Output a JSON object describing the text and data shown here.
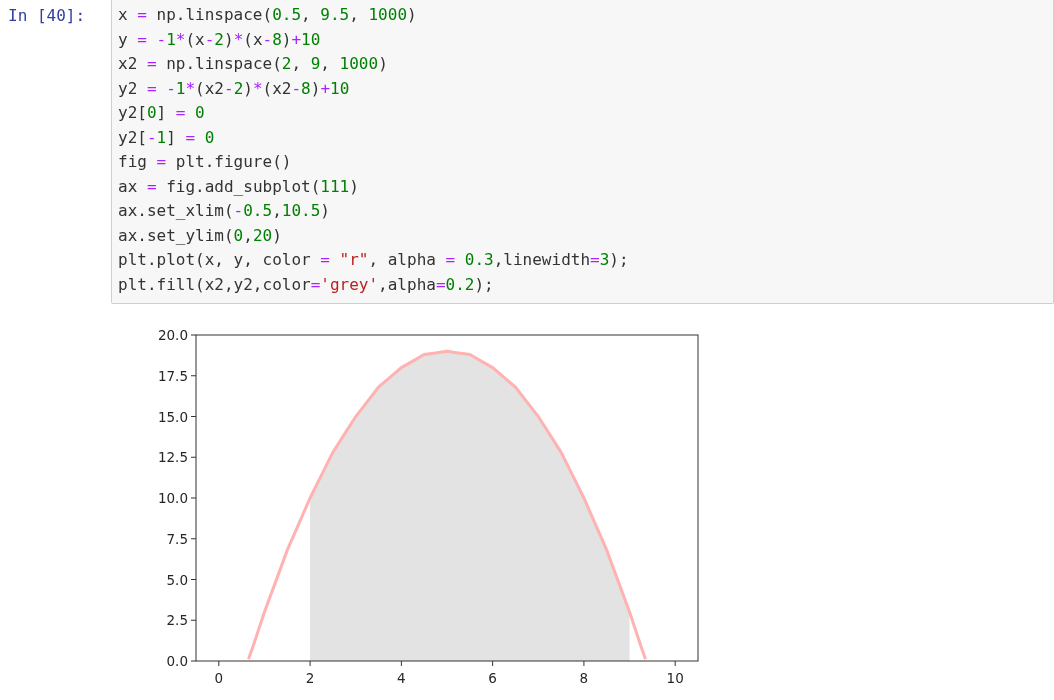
{
  "cell": {
    "prompt": "In [40]:",
    "code_lines": [
      [
        {
          "kind": "plain",
          "text": "x "
        },
        {
          "kind": "op",
          "text": "="
        },
        {
          "kind": "plain",
          "text": " np.linspace("
        },
        {
          "kind": "num",
          "text": "0.5"
        },
        {
          "kind": "plain",
          "text": ", "
        },
        {
          "kind": "num",
          "text": "9.5"
        },
        {
          "kind": "plain",
          "text": ", "
        },
        {
          "kind": "num",
          "text": "1000"
        },
        {
          "kind": "plain",
          "text": ")"
        }
      ],
      [
        {
          "kind": "plain",
          "text": "y "
        },
        {
          "kind": "op",
          "text": "= -"
        },
        {
          "kind": "num",
          "text": "1"
        },
        {
          "kind": "op",
          "text": "*"
        },
        {
          "kind": "plain",
          "text": "(x"
        },
        {
          "kind": "op",
          "text": "-"
        },
        {
          "kind": "num",
          "text": "2"
        },
        {
          "kind": "plain",
          "text": ")"
        },
        {
          "kind": "op",
          "text": "*"
        },
        {
          "kind": "plain",
          "text": "(x"
        },
        {
          "kind": "op",
          "text": "-"
        },
        {
          "kind": "num",
          "text": "8"
        },
        {
          "kind": "plain",
          "text": ")"
        },
        {
          "kind": "op",
          "text": "+"
        },
        {
          "kind": "num",
          "text": "10"
        }
      ],
      [
        {
          "kind": "plain",
          "text": "x2 "
        },
        {
          "kind": "op",
          "text": "="
        },
        {
          "kind": "plain",
          "text": " np.linspace("
        },
        {
          "kind": "num",
          "text": "2"
        },
        {
          "kind": "plain",
          "text": ", "
        },
        {
          "kind": "num",
          "text": "9"
        },
        {
          "kind": "plain",
          "text": ", "
        },
        {
          "kind": "num",
          "text": "1000"
        },
        {
          "kind": "plain",
          "text": ")"
        }
      ],
      [
        {
          "kind": "plain",
          "text": "y2 "
        },
        {
          "kind": "op",
          "text": "= -"
        },
        {
          "kind": "num",
          "text": "1"
        },
        {
          "kind": "op",
          "text": "*"
        },
        {
          "kind": "plain",
          "text": "(x2"
        },
        {
          "kind": "op",
          "text": "-"
        },
        {
          "kind": "num",
          "text": "2"
        },
        {
          "kind": "plain",
          "text": ")"
        },
        {
          "kind": "op",
          "text": "*"
        },
        {
          "kind": "plain",
          "text": "(x2"
        },
        {
          "kind": "op",
          "text": "-"
        },
        {
          "kind": "num",
          "text": "8"
        },
        {
          "kind": "plain",
          "text": ")"
        },
        {
          "kind": "op",
          "text": "+"
        },
        {
          "kind": "num",
          "text": "10"
        }
      ],
      [
        {
          "kind": "plain",
          "text": "y2["
        },
        {
          "kind": "num",
          "text": "0"
        },
        {
          "kind": "plain",
          "text": "] "
        },
        {
          "kind": "op",
          "text": "="
        },
        {
          "kind": "num",
          "text": " 0"
        }
      ],
      [
        {
          "kind": "plain",
          "text": "y2["
        },
        {
          "kind": "op",
          "text": "-"
        },
        {
          "kind": "num",
          "text": "1"
        },
        {
          "kind": "plain",
          "text": "] "
        },
        {
          "kind": "op",
          "text": "="
        },
        {
          "kind": "num",
          "text": " 0"
        }
      ],
      [
        {
          "kind": "plain",
          "text": "fig "
        },
        {
          "kind": "op",
          "text": "="
        },
        {
          "kind": "plain",
          "text": " plt.figure()"
        }
      ],
      [
        {
          "kind": "plain",
          "text": "ax "
        },
        {
          "kind": "op",
          "text": "="
        },
        {
          "kind": "plain",
          "text": " fig.add_subplot("
        },
        {
          "kind": "num",
          "text": "111"
        },
        {
          "kind": "plain",
          "text": ")"
        }
      ],
      [
        {
          "kind": "plain",
          "text": "ax.set_xlim("
        },
        {
          "kind": "op",
          "text": "-"
        },
        {
          "kind": "num",
          "text": "0.5"
        },
        {
          "kind": "plain",
          "text": ","
        },
        {
          "kind": "num",
          "text": "10.5"
        },
        {
          "kind": "plain",
          "text": ")"
        }
      ],
      [
        {
          "kind": "plain",
          "text": "ax.set_ylim("
        },
        {
          "kind": "num",
          "text": "0"
        },
        {
          "kind": "plain",
          "text": ","
        },
        {
          "kind": "num",
          "text": "20"
        },
        {
          "kind": "plain",
          "text": ")"
        }
      ],
      [
        {
          "kind": "plain",
          "text": "plt.plot(x, y, color "
        },
        {
          "kind": "op",
          "text": "="
        },
        {
          "kind": "str",
          "text": " \"r\""
        },
        {
          "kind": "plain",
          "text": ", alpha "
        },
        {
          "kind": "op",
          "text": "="
        },
        {
          "kind": "num",
          "text": " 0.3"
        },
        {
          "kind": "plain",
          "text": ",linewidth"
        },
        {
          "kind": "op",
          "text": "="
        },
        {
          "kind": "num",
          "text": "3"
        },
        {
          "kind": "plain",
          "text": ");"
        }
      ],
      [
        {
          "kind": "plain",
          "text": "plt.fill(x2,y2,color"
        },
        {
          "kind": "op",
          "text": "="
        },
        {
          "kind": "str",
          "text": "'grey'"
        },
        {
          "kind": "plain",
          "text": ",alpha"
        },
        {
          "kind": "op",
          "text": "="
        },
        {
          "kind": "num",
          "text": "0.2"
        },
        {
          "kind": "plain",
          "text": ");"
        }
      ]
    ]
  },
  "output": {
    "chart_data": {
      "type": "line",
      "x": [
        0.65,
        0.75,
        1,
        1.25,
        1.5,
        1.75,
        2,
        2.25,
        2.5,
        2.75,
        3,
        3.25,
        3.5,
        3.75,
        4,
        4.25,
        4.5,
        4.75,
        5,
        5.25,
        5.5,
        5.75,
        6,
        6.25,
        6.5,
        6.75,
        7,
        7.25,
        7.5,
        7.75,
        8,
        8.25,
        8.5,
        8.75,
        9,
        9.25,
        9.35
      ],
      "series": [
        {
          "type": "line",
          "color": "#ffb2b2",
          "values": [
            0.1,
            0.9,
            3,
            4.9,
            6.8,
            8.4,
            10,
            11.4,
            12.8,
            13.9,
            15,
            15.9,
            16.8,
            17.4,
            18,
            18.4,
            18.8,
            18.9,
            19,
            18.9,
            18.8,
            18.4,
            18,
            17.4,
            16.8,
            15.9,
            15,
            13.9,
            12.8,
            11.4,
            10,
            8.4,
            6.8,
            4.9,
            3,
            0.9,
            0.1
          ]
        },
        {
          "type": "area",
          "color": "#e3e3e3",
          "values": [
            null,
            null,
            null,
            null,
            null,
            null,
            10,
            11.4,
            12.8,
            13.9,
            15,
            15.9,
            16.8,
            17.4,
            18,
            18.4,
            18.8,
            18.9,
            19,
            18.9,
            18.8,
            18.4,
            18,
            17.4,
            16.8,
            15.9,
            15,
            13.9,
            12.8,
            11.4,
            10,
            8.4,
            6.8,
            4.9,
            3,
            null,
            null
          ]
        }
      ],
      "xlim": [
        -0.5,
        10.5
      ],
      "ylim": [
        0,
        20
      ],
      "xticks": [
        0,
        2,
        4,
        6,
        8,
        10
      ],
      "yticks": [
        {
          "value": 0,
          "label": "0.0"
        },
        {
          "value": 2.5,
          "label": "2.5"
        },
        {
          "value": 5,
          "label": "5.0"
        },
        {
          "value": 7.5,
          "label": "7.5"
        },
        {
          "value": 10,
          "label": "10.0"
        },
        {
          "value": 12.5,
          "label": "12.5"
        },
        {
          "value": 15,
          "label": "15.0"
        },
        {
          "value": 17.5,
          "label": "17.5"
        },
        {
          "value": 20,
          "label": "20.0"
        }
      ]
    }
  }
}
